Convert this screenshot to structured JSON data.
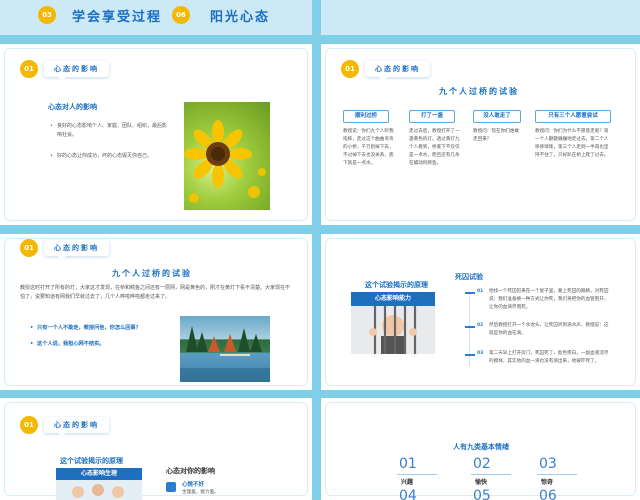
{
  "slide1": {
    "num": "03",
    "title": "学会享受过程",
    "num2": "06",
    "title2": "阳光心态"
  },
  "slide3": {
    "num": "01",
    "tag": "心态的影响",
    "subtitle": "心态对人的影响",
    "bullets": [
      "良好的心态影响个人、家庭、团队、组织，最后影响社会。",
      "好的心态让你成功，坏的心态毁灭你自己。"
    ],
    "image": "sunflower-photo"
  },
  "slide4": {
    "num": "01",
    "tag": "心态的影响",
    "title": "九个人过桥的试验",
    "columns": [
      {
        "head": "顺利过桥",
        "text": "教授说：你们九个人听我指挥，走过这个曲曲弯弯的小桥，千万别掉下去，不过掉下去也没关系，底下就是一点水。"
      },
      {
        "head": "打了一盏",
        "text": "走过去后，教授打开了一盏黄色的灯。透过黄灯九个人看到，桥底下不仅仅是一点水，而且还有几条在蠕动的鳄鱼。"
      },
      {
        "head": "没人敢走了",
        "text": "教授问：现在你们谁敢走回来？"
      },
      {
        "head": "只有三个人愿意尝试",
        "text": "教授问：你们为什么不愿意走呢？第一个人颤颤巍巍地走过去，第二个人哆哆嗦嗦，第三个人走到一半再也坚持不住了，只好趴在桥上爬了过去。"
      }
    ]
  },
  "slide5": {
    "num": "01",
    "tag": "心态的影响",
    "title": "九个人过桥的试验",
    "paragraph": "教授这时打开了所有的灯，大家这才发现，在桥和鳄鱼之间还有一层网，网是黄色的，刚才在黄灯下看不清楚。大家现在不怕了，说要知道有网我们早就过去了，几个人哗啦哗啦都走过来了。",
    "bullets": [
      "只有一个人不敢走，教授问他，你怎么回事？",
      "这个人说，我担心网不结实。"
    ],
    "image": "lake-landscape-photo"
  },
  "slide6": {
    "tag_title": "这个试验揭示的原理",
    "image_caption": "心态影响能力",
    "side_title": "死囚试验",
    "steps": [
      {
        "num": "01",
        "text": "他找一个死囚犯来在一个屋子里，蒙上死囚的眼睛，对死囚说：我们准备换一种方式让你死，我们将把你的血管割开，让你的血滴尽而死。"
      },
      {
        "num": "02",
        "text": "然后教授打开一个水龙头，让死囚听到滴水声，教授说：这就是你的血在滴。"
      },
      {
        "num": "03",
        "text": "第二天早上打开房门，死囚死了，脸色惨白，一副血液流尽的模样，其实他的血一滴也没有滴出来，他被吓死了。"
      }
    ]
  },
  "slide7": {
    "num": "01",
    "tag": "心态的影响",
    "left_title": "这个试验揭示的原理",
    "left_banner": "心态影响生理",
    "right_title": "心态对你的影响",
    "item_title": "心情不好",
    "item_text": "生理差，能力差。"
  },
  "slide8": {
    "title": "人有九类基本情绪",
    "emotions": [
      {
        "num": "01",
        "label": "兴趣"
      },
      {
        "num": "02",
        "label": "愉快"
      },
      {
        "num": "03",
        "label": "惊奇"
      },
      {
        "num": "04",
        "label": ""
      },
      {
        "num": "05",
        "label": ""
      },
      {
        "num": "06",
        "label": ""
      }
    ]
  }
}
